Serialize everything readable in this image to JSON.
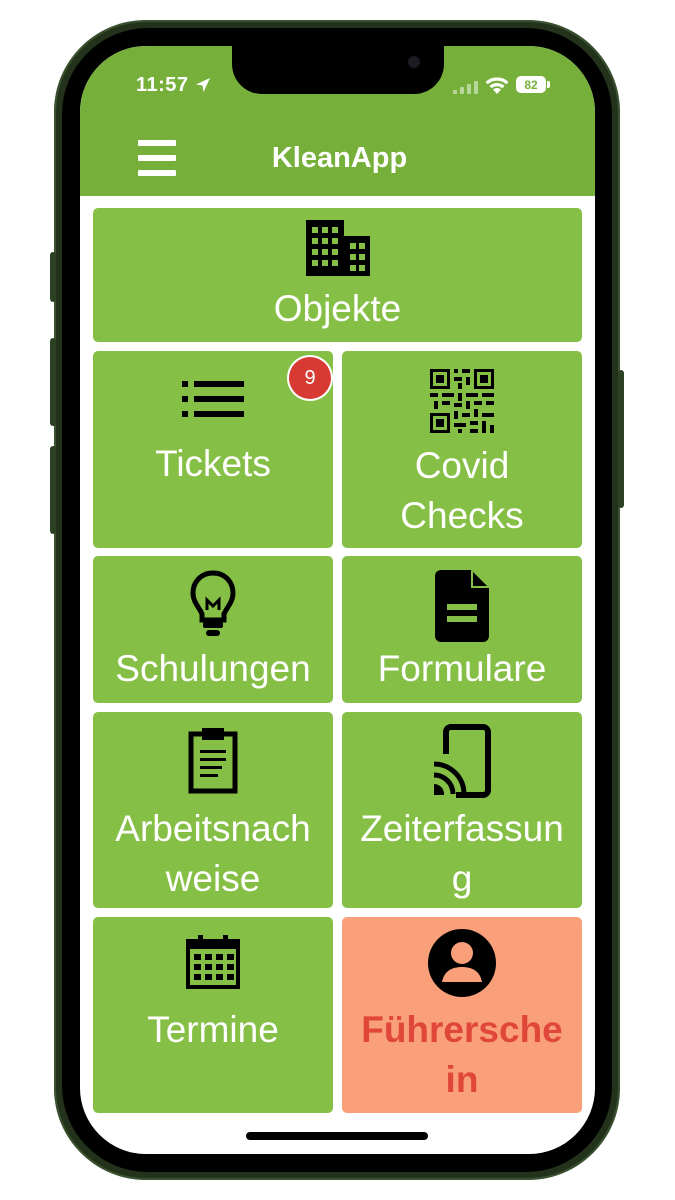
{
  "status_bar": {
    "time": "11:57",
    "battery": "82"
  },
  "header": {
    "title": "KleanApp",
    "icon": "hamburger-menu-icon",
    "background": "#76b03a"
  },
  "tiles": [
    {
      "label": "Objekte",
      "icon": "building-icon"
    },
    {
      "label": "Tickets",
      "icon": "list-icon",
      "badge": "9"
    },
    {
      "label": "Covid\nChecks",
      "icon": "qr-code-icon"
    },
    {
      "label": "Schulungen",
      "icon": "lightbulb-icon"
    },
    {
      "label": "Formulare",
      "icon": "document-icon"
    },
    {
      "label": "Arbeitsnach\nweise",
      "icon": "clipboard-icon"
    },
    {
      "label": "Zeiterfassun\ng",
      "icon": "cast-device-icon"
    },
    {
      "label": "Termine",
      "icon": "calendar-icon"
    },
    {
      "label": "Führersche\nin",
      "icon": "user-circle-icon"
    }
  ],
  "colors": {
    "tile": "#86bf45",
    "tile_highlight": "#f99f7a",
    "tile_highlight_text": "#e0473a",
    "badge": "#d73a33"
  }
}
